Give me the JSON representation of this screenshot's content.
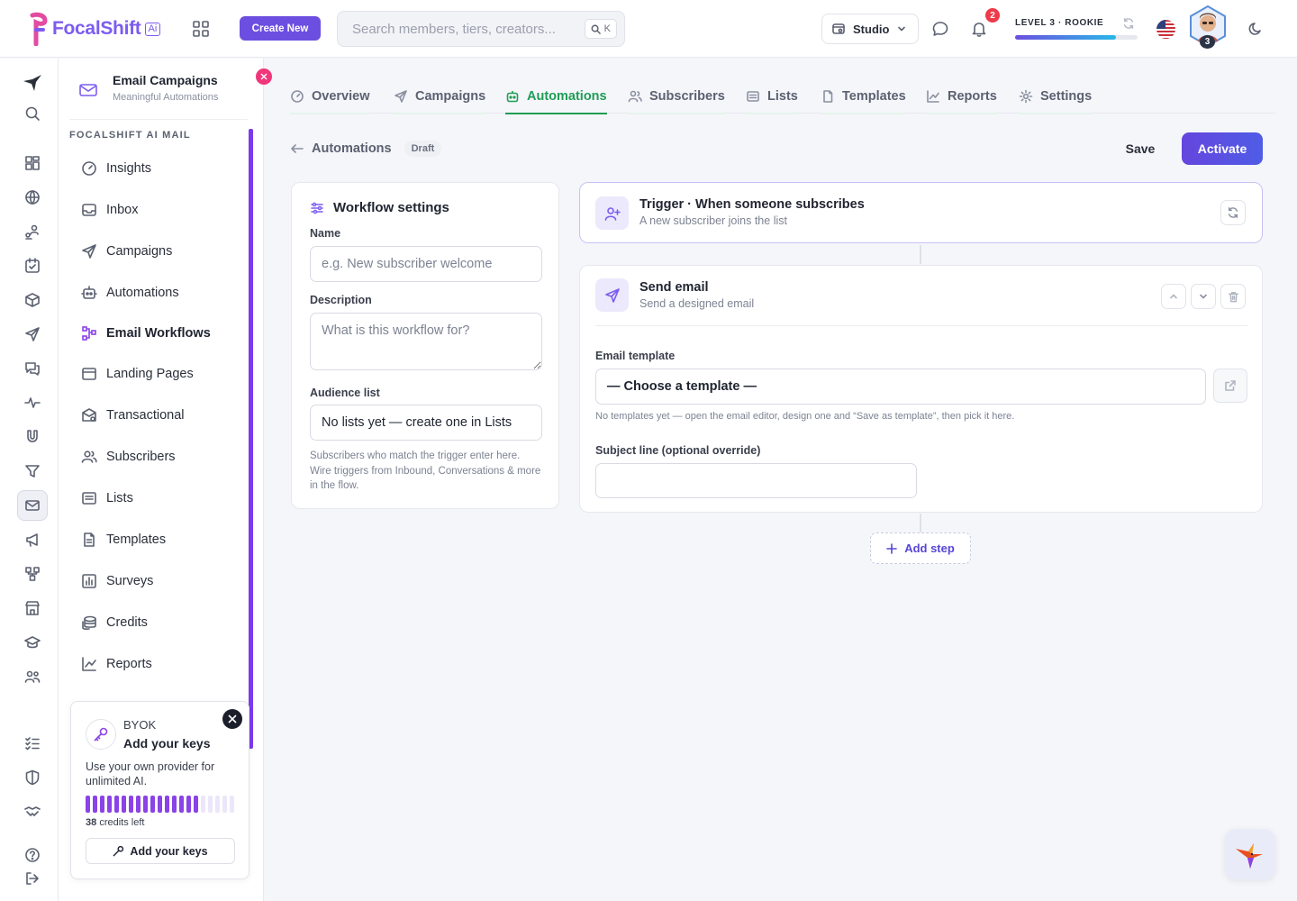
{
  "brand": {
    "name": "FocalShift",
    "ai_badge": "Ai"
  },
  "topbar": {
    "create_label": "Create New",
    "search_placeholder": "Search members, tiers, creators...",
    "search_shortcut": "K",
    "workspace": "Studio",
    "notifications_count": "2",
    "level_label": "LEVEL 3 · ROOKIE",
    "level_progress": 0.82,
    "avatar_level": "3"
  },
  "sidebar": {
    "title": "Email Campaigns",
    "subtitle": "Meaningful Automations",
    "section": "FOCALSHIFT AI MAIL",
    "items": [
      {
        "label": "Insights"
      },
      {
        "label": "Inbox"
      },
      {
        "label": "Campaigns"
      },
      {
        "label": "Automations"
      },
      {
        "label": "Email Workflows"
      },
      {
        "label": "Landing Pages"
      },
      {
        "label": "Transactional"
      },
      {
        "label": "Subscribers"
      },
      {
        "label": "Lists"
      },
      {
        "label": "Templates"
      },
      {
        "label": "Surveys"
      },
      {
        "label": "Credits"
      },
      {
        "label": "Reports"
      }
    ]
  },
  "byok": {
    "kicker": "BYOK",
    "title": "Add your keys",
    "description": "Use your own provider for unlimited AI.",
    "credits": "38",
    "credits_suffix": "credits left",
    "credit_fraction": 0.76,
    "button": "Add your keys"
  },
  "tabs": [
    {
      "label": "Overview"
    },
    {
      "label": "Campaigns"
    },
    {
      "label": "Automations"
    },
    {
      "label": "Subscribers"
    },
    {
      "label": "Lists"
    },
    {
      "label": "Templates"
    },
    {
      "label": "Reports"
    },
    {
      "label": "Settings"
    }
  ],
  "breadcrumb": {
    "back_label": "Automations",
    "status": "Draft"
  },
  "actions": {
    "save": "Save",
    "activate": "Activate"
  },
  "workflow_settings": {
    "title": "Workflow settings",
    "name_label": "Name",
    "name_placeholder": "e.g. New subscriber welcome",
    "description_label": "Description",
    "description_placeholder": "What is this workflow for?",
    "audience_label": "Audience list",
    "audience_value": "No lists yet — create one in Lists",
    "help": "Subscribers who match the trigger enter here. Wire triggers from Inbound, Conversations & more in the flow."
  },
  "trigger": {
    "title": "Trigger · When someone subscribes",
    "subtitle": "A new subscriber joins the list"
  },
  "send_email": {
    "title": "Send email",
    "subtitle": "Send a designed email",
    "template_label": "Email template",
    "template_value": "— Choose a template —",
    "template_help": "No templates yet — open the email editor, design one and “Save as template”, then pick it here.",
    "subject_label": "Subject line (optional override)",
    "subject_value": ""
  },
  "add_step": "Add step"
}
